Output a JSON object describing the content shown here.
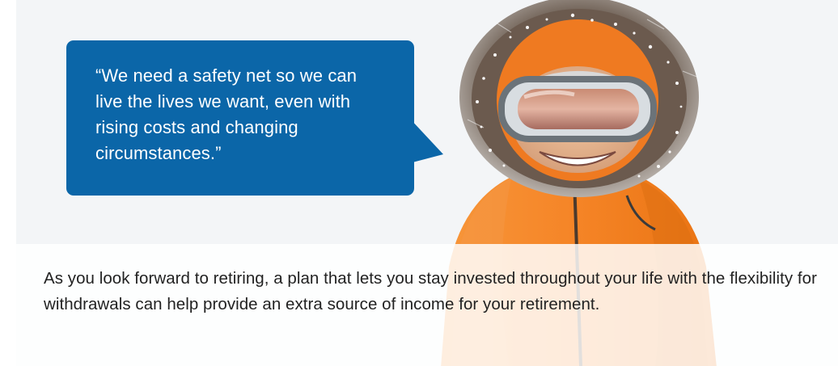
{
  "quote": {
    "text": "“We need a safety net so we can live the lives we want, even with rising costs and changing circumstances.”"
  },
  "caption": {
    "text": "As you look forward to retiring, a plan that lets you stay invested throughout your life with the flexibility for withdrawals can help provide an extra source of income for your retirement."
  },
  "colors": {
    "bubble": "#0b66a8",
    "jacket": "#f58a2a",
    "background": "#f4f6f8"
  }
}
